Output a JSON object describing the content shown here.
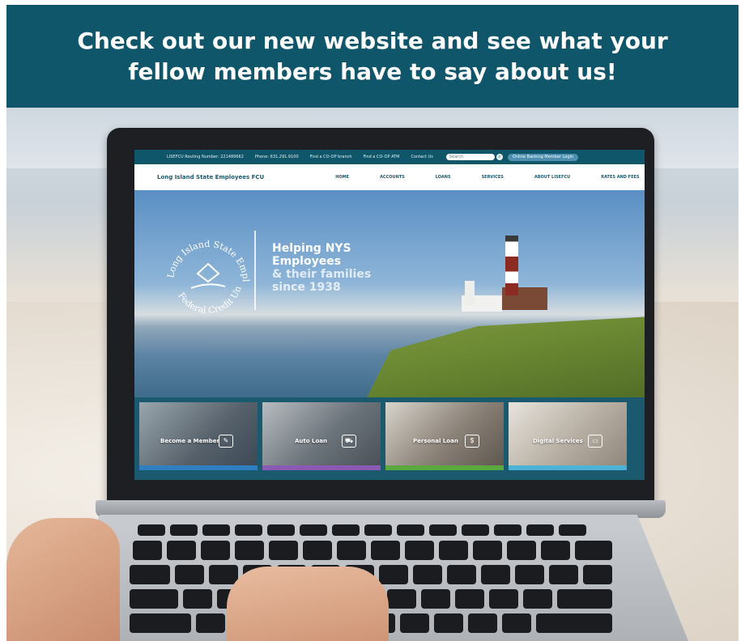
{
  "banner": {
    "headline": "Check out our new website and see what your fellow members have to say about us!"
  },
  "site": {
    "topbar": {
      "routing": "LISEFCU Routing Number: 221489662",
      "phone": "Phone: 631.291.9100",
      "find_branch": "Find a CO-OP branch",
      "find_atm": "Find a CO-OP ATM",
      "contact": "Contact Us",
      "search_placeholder": "Search",
      "login": "Online Banking Member Login"
    },
    "nav": {
      "brand": "Long Island State Employees FCU",
      "items": [
        "HOME",
        "ACCOUNTS",
        "LOANS",
        "SERVICES",
        "ABOUT LISEFCU",
        "RATES AND FEES"
      ]
    },
    "hero": {
      "seal_top": "Long Island State Employees",
      "seal_bottom": "Federal Credit Union",
      "tagline": [
        "Helping NYS",
        "Employees",
        "& their families",
        "since 1938"
      ]
    },
    "cards": [
      {
        "label": "Become a Member",
        "color": "#2f7fc1"
      },
      {
        "label": "Auto Loan",
        "color": "#8a5bb5"
      },
      {
        "label": "Personal Loan",
        "color": "#5aa840"
      },
      {
        "label": "Digital Services",
        "color": "#4cb3d6"
      }
    ]
  },
  "colors": {
    "banner_bg": "#0f566b",
    "banner_text": "#ffffff"
  }
}
